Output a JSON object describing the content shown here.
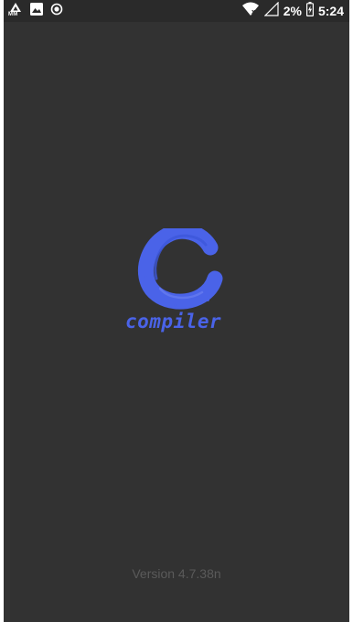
{
  "status_bar": {
    "left_icons": [
      "mm-icon",
      "image-icon",
      "record-icon"
    ],
    "mm_label": "MM",
    "right_icons": [
      "wifi-icon",
      "signal-icon",
      "battery-icon"
    ],
    "battery": "2%",
    "time": "5:24"
  },
  "splash": {
    "logo_letter_icon": "c-letter-icon",
    "app_name": "compiler",
    "version": "Version 4.7.38n"
  },
  "colors": {
    "background": "#323232",
    "status_bar": "#2a2a2a",
    "brand": "#4a63e8",
    "version_text": "#5a5a5a"
  }
}
